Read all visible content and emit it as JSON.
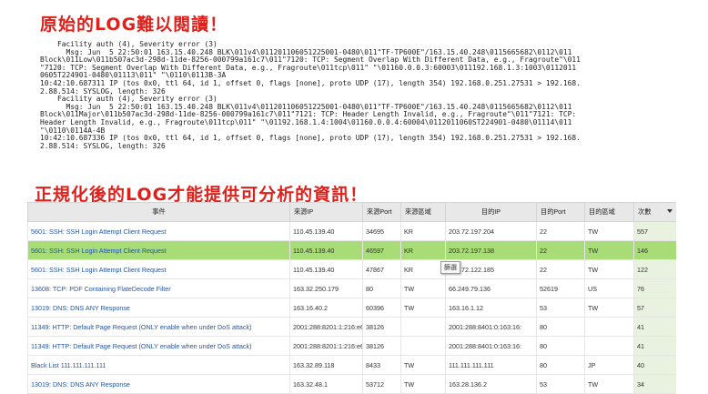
{
  "headings": {
    "raw": "原始的LOG難以閱讀！",
    "normalized": "正規化後的LOG才能提供可分析的資訊！"
  },
  "raw_log": [
    "    Facility auth (4), Severity error (3)",
    "      Msg: Jun  5 22:50:01 163.15.40.248 BLK\\011v4\\011201106051225001-0480\\011\"TF-TP600E\"/163.15.40.248\\0115665682\\0112\\011",
    "Block\\011Low\\011b507ac3d-298d-11de-8256-000799a161c7\\011\"7120: TCP: Segment Overlap With Different Data, e.g., Fragroute\"\\011",
    "\"7120: TCP: Segment Overlap With Different Data, e.g., Fragroute\\011tcp\\011\" \"\\01160.0.0.3:60003\\011192.168.1.3:1003\\0112011",
    "0605T224901-0480\\01113\\011\" \"\\0110\\0113B-3A",
    "10:42:10.687311 IP (tos 0x0, ttl 64, id 1, offset 0, flags [none], proto UDP (17), length 354) 192.168.0.251.27531 > 192.168.",
    "2.88.514: SYSLOG, length: 326",
    "    Facility auth (4), Severity error (3)",
    "      Msg: Jun  5 22:50:01 163.15.40.248 BLK\\011v4\\011201106051225001-0480\\011\"TF-TP600E\"/163.15.40.248\\0115665682\\0112\\011",
    "Block\\011Major\\011b507ac3d-298d-11de-8256-000799a161c7\\011\"7121: TCP: Header Length Invalid, e.g., Fragroute\"\\011\"7121: TCP:",
    "Header Length Invalid, e.g., Fragroute\\011tcp\\011\" \"\\01192.168.1.4:1004\\01160.0.0.4:60004\\0112011060ST224901-0480\\01114\\011",
    "\"\\0110\\0114A-4B",
    "10:42:10.687336 IP (tos 0x0, ttl 64, id 1, offset 0, flags [none], proto UDP (17), length 354) 192.168.0.251.27531 > 192.168.",
    "2.88.514: SYSLOG, length: 326"
  ],
  "table": {
    "columns": [
      "事件",
      "來源IP",
      "來源Port",
      "來源區域",
      "目的IP",
      "目的Port",
      "目的區域",
      "次數"
    ],
    "rows": [
      {
        "event": "5601: SSH: SSH Login Attempt Client Request",
        "src_ip": "110.45.139.40",
        "src_port": "34695",
        "src_zone": "KR",
        "dst_ip": "203.72.197.204",
        "dst_port": "22",
        "dst_zone": "TW",
        "count": "557"
      },
      {
        "event": "5601: SSH: SSH Login Attempt Client Request",
        "src_ip": "110.45.139.40",
        "src_port": "46597",
        "src_zone": "KR",
        "dst_ip": "203.72.197.138",
        "dst_port": "22",
        "dst_zone": "TW",
        "count": "146"
      },
      {
        "event": "5601: SSH: SSH Login Attempt Client Request",
        "src_ip": "110.45.139.40",
        "src_port": "47867",
        "src_zone": "KR",
        "dst_ip": "203.72.122.185",
        "dst_port": "22",
        "dst_zone": "TW",
        "count": "122"
      },
      {
        "event": "13608: TCP: PDF Containing FlateDecode Filter",
        "src_ip": "163.32.250.179",
        "src_port": "80",
        "src_zone": "TW",
        "dst_ip": "66.249.79.136",
        "dst_port": "52619",
        "dst_zone": "US",
        "count": "76"
      },
      {
        "event": "13019: DNS: DNS ANY Response",
        "src_ip": "163.16.40.2",
        "src_port": "60396",
        "src_zone": "TW",
        "dst_ip": "163.16.1.12",
        "dst_port": "53",
        "dst_zone": "TW",
        "count": "57"
      },
      {
        "event": "11349: HTTP: Default Page Request (ONLY enable when under DoS attack)",
        "src_ip": "2001:288:8201:1:216:e6ff:",
        "src_port": "38126",
        "src_zone": "",
        "dst_ip": "2001:288:8401:0:163:16:",
        "dst_port": "80",
        "dst_zone": "",
        "count": "41"
      },
      {
        "event": "11349: HTTP: Default Page Request (ONLY enable when under DoS attack)",
        "src_ip": "2001:288:8201:1:216:e6ff:",
        "src_port": "38126",
        "src_zone": "",
        "dst_ip": "2001:288:8401:0:163:16:",
        "dst_port": "80",
        "dst_zone": "",
        "count": "41"
      },
      {
        "event": "Black List 111.111.111.111",
        "src_ip": "163.32.89.118",
        "src_port": "8433",
        "src_zone": "TW",
        "dst_ip": "111.111.111.111",
        "dst_port": "80",
        "dst_zone": "JP",
        "count": "40"
      },
      {
        "event": "13019: DNS: DNS ANY Response",
        "src_ip": "163.32.48.1",
        "src_port": "53712",
        "src_zone": "TW",
        "dst_ip": "163.28.136.2",
        "dst_port": "53",
        "dst_zone": "TW",
        "count": "34"
      }
    ],
    "selected_row": 1,
    "tooltip": "篩選"
  },
  "colors": {
    "heading": "#e0201a",
    "selected_row": "#a7dc76",
    "link": "#2555a4",
    "count_column": "#e8f2df"
  },
  "icons": {
    "sort": "sort-descending-icon"
  }
}
